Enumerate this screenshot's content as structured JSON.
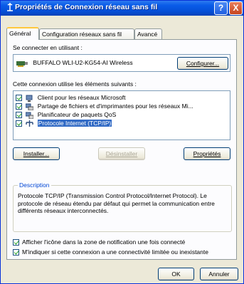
{
  "window": {
    "title": "Propriétés de Connexion réseau sans fil",
    "help_label": "?",
    "close_label": "X"
  },
  "tabs": [
    {
      "label": "Général",
      "active": true
    },
    {
      "label": "Configuration réseaux sans fil",
      "active": false
    },
    {
      "label": "Avancé",
      "active": false
    }
  ],
  "general": {
    "connect_label": "Se connecter en utilisant :",
    "adapter_name": "BUFFALO WLI-U2-KG54-AI Wireless",
    "configure_button": "Configurer...",
    "items_label": "Cette connexion utilise les éléments suivants :",
    "items": [
      {
        "label": "Client pour les réseaux Microsoft",
        "checked": true,
        "icon": "network-client-icon"
      },
      {
        "label": "Partage de fichiers et d'imprimantes pour les réseaux Mi...",
        "checked": true,
        "icon": "file-printer-sharing-icon"
      },
      {
        "label": "Planificateur de paquets QoS",
        "checked": true,
        "icon": "qos-scheduler-icon"
      },
      {
        "label": "Protocole Internet (TCP/IP)",
        "checked": true,
        "selected": true,
        "icon": "protocol-icon"
      }
    ],
    "install_button": "Installer...",
    "uninstall_button": "Désinstaller",
    "properties_button": "Propriétés",
    "description_title": "Description",
    "description_text": "Protocole TCP/IP (Transmission Control Protocol/Internet Protocol). Le protocole de réseau étendu par défaut qui permet la communication entre différents réseaux interconnectés.",
    "show_icon_label": "Afficher l'icône dans la zone de notification une fois connecté",
    "notify_label": "M'indiquer si cette connexion a une connectivité limitée ou inexistante"
  },
  "footer": {
    "ok_button": "OK",
    "cancel_button": "Annuler"
  }
}
